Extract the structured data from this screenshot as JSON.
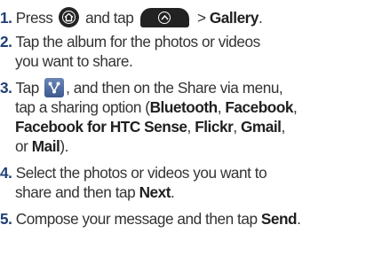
{
  "steps": [
    {
      "num": "1.",
      "text_a": "Press",
      "text_b": "and tap",
      "text_c": "> ",
      "bold": "Gallery",
      "text_d": "."
    },
    {
      "num": "2.",
      "line1": "Tap the album for the photos or videos",
      "line2": "you want to share."
    },
    {
      "num": "3.",
      "a": "Tap",
      "b": ", and then on the Share via menu,",
      "c": "tap a sharing option (",
      "d": "Bluetooth",
      "e": ", ",
      "f": "Facebook",
      "g": ",",
      "h": "Facebook for HTC Sense",
      "i": ", ",
      "j": "Flickr",
      "k": ", ",
      "l": "Gmail",
      "m": ",",
      "n": "or ",
      "o": "Mail",
      "p": ")."
    },
    {
      "num": "4.",
      "line1": "Select the photos or videos you want  to",
      "line2a": "share and then tap ",
      "line2b": "Next",
      "line2c": "."
    },
    {
      "num": "5.",
      "a": "Compose your message and then tap ",
      "b": "Send",
      "c": "."
    }
  ],
  "icons": {
    "home": "home-button-icon",
    "launcher": "all-apps-launcher-icon",
    "share": "share-icon"
  },
  "colors": {
    "number": "#1f3f75",
    "text": "#333333",
    "share_icon": "#4a66a0"
  }
}
